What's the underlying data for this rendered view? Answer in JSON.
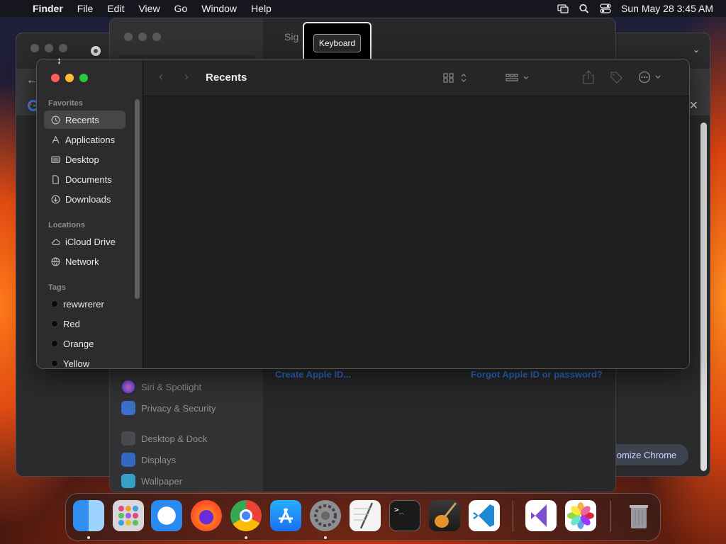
{
  "menubar": {
    "app": "Finder",
    "items": [
      "File",
      "Edit",
      "View",
      "Go",
      "Window",
      "Help"
    ],
    "datetime": "Sun May 28  3:45 AM"
  },
  "chrome": {
    "customize_label": "omize Chrome"
  },
  "settings": {
    "title": "Sig",
    "sidebar": [
      "Siri & Spotlight",
      "Privacy & Security",
      "Desktop & Dock",
      "Displays",
      "Wallpaper"
    ],
    "create_link": "Create Apple ID...",
    "forgot_link": "Forgot Apple ID or password?"
  },
  "tooltip": {
    "label": "Keyboard"
  },
  "finder": {
    "title": "Recents",
    "sections": {
      "favorites": "Favorites",
      "locations": "Locations",
      "tags": "Tags"
    },
    "favorites": [
      "Recents",
      "Applications",
      "Desktop",
      "Documents",
      "Downloads"
    ],
    "locations": [
      "iCloud Drive",
      "Network"
    ],
    "tags": [
      "rewwrerer",
      "Red",
      "Orange",
      "Yellow"
    ]
  },
  "dock": {
    "apps": [
      "finder",
      "launchpad",
      "safari",
      "firefox",
      "chrome",
      "app-store",
      "system-settings",
      "textedit",
      "terminal",
      "garageband",
      "vscode",
      "visual-studio",
      "photos",
      "trash"
    ]
  },
  "colors": {
    "accent": "#2e6fd8",
    "close": "#ff5f57",
    "minimize": "#febc2e",
    "zoom": "#28c840"
  }
}
